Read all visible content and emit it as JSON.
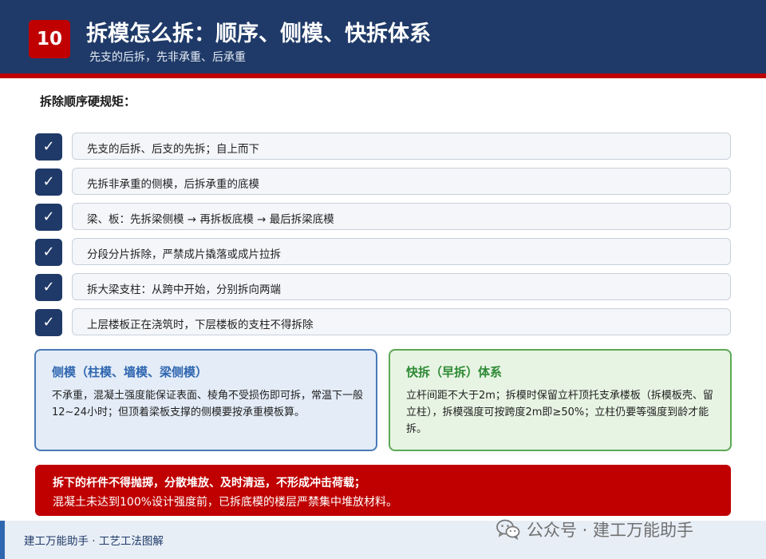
{
  "header": {
    "number": "10",
    "title": "拆模怎么拆：顺序、侧模、快拆体系",
    "subtitle": "先支的后拆，先非承重、后承重"
  },
  "rules": {
    "heading": "拆除顺序硬规矩：",
    "check_glyph": "✓",
    "items": [
      "先支的后拆、后支的先拆；自上而下",
      "先拆非承重的侧模，后拆承重的底模",
      "梁、板：先拆梁侧模 → 再拆板底模 → 最后拆梁底模",
      "分段分片拆除，严禁成片撬落或成片拉拆",
      "拆大梁支柱：从跨中开始，分别拆向两端",
      "上层楼板正在浇筑时，下层楼板的支柱不得拆除"
    ]
  },
  "cards": {
    "side_form": {
      "title": "侧模（柱模、墙模、梁侧模）",
      "body": "不承重，混凝土强度能保证表面、棱角不受损伤即可拆，常温下一般12~24小时；但顶着梁板支撑的侧模要按承重模板算。"
    },
    "quick_strip": {
      "title": "快拆（早拆）体系",
      "body": "立杆间距不大于2m；拆模时保留立杆顶托支承楼板（拆模板壳、留立柱），拆模强度可按跨度2m即≥50%；立柱仍要等强度到龄才能拆。"
    }
  },
  "warning": {
    "line1": "拆下的杆件不得抛掷，分散堆放、及时清运，不形成冲击荷载；",
    "line2": "混凝土未达到100%设计强度前，已拆底模的楼层严禁集中堆放材料。"
  },
  "footer": {
    "text": "建工万能助手 · 工艺工法图解",
    "watermark": "公众号 · 建工万能助手",
    "watermark_icon": "wechat-icon"
  },
  "colors": {
    "navy": "#1f3a68",
    "red": "#c00000",
    "blue_title": "#2f66b0",
    "green_title": "#2e8a35"
  }
}
